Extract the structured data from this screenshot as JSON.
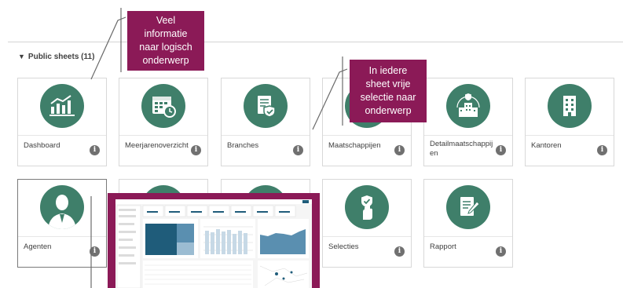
{
  "section": {
    "caret": "▼",
    "title": "Public sheets (11)"
  },
  "sheets": [
    {
      "label": "Dashboard",
      "icon": "bar-chart-icon"
    },
    {
      "label": "Meerjarenoverzicht",
      "icon": "calendar-clock-icon"
    },
    {
      "label": "Branches",
      "icon": "document-shield-icon"
    },
    {
      "label": "Maatschappijen",
      "icon": "company-icon"
    },
    {
      "label": "Detailmaatschappij\nen",
      "icon": "buildings-shield-icon"
    },
    {
      "label": "Kantoren",
      "icon": "office-building-icon"
    },
    {
      "label": "Agenten",
      "icon": "agent-person-icon"
    },
    {
      "label": "",
      "icon": "sheet-icon"
    },
    {
      "label": "",
      "icon": "sheet-icon"
    },
    {
      "label": "Selecties",
      "icon": "hand-shield-check-icon"
    },
    {
      "label": "Rapport",
      "icon": "report-pencil-icon"
    }
  ],
  "info_glyph": "i",
  "callouts": [
    {
      "text": "Veel\ninformatie\nnaar logisch\nonderwerp"
    },
    {
      "text": "In iedere\nsheet vrije\nselectie naar\nonderwerp"
    }
  ],
  "colors": {
    "icon_circle": "#3f7f6a",
    "callout": "#8b1a57",
    "preview_accent": "#1f5c7a"
  }
}
